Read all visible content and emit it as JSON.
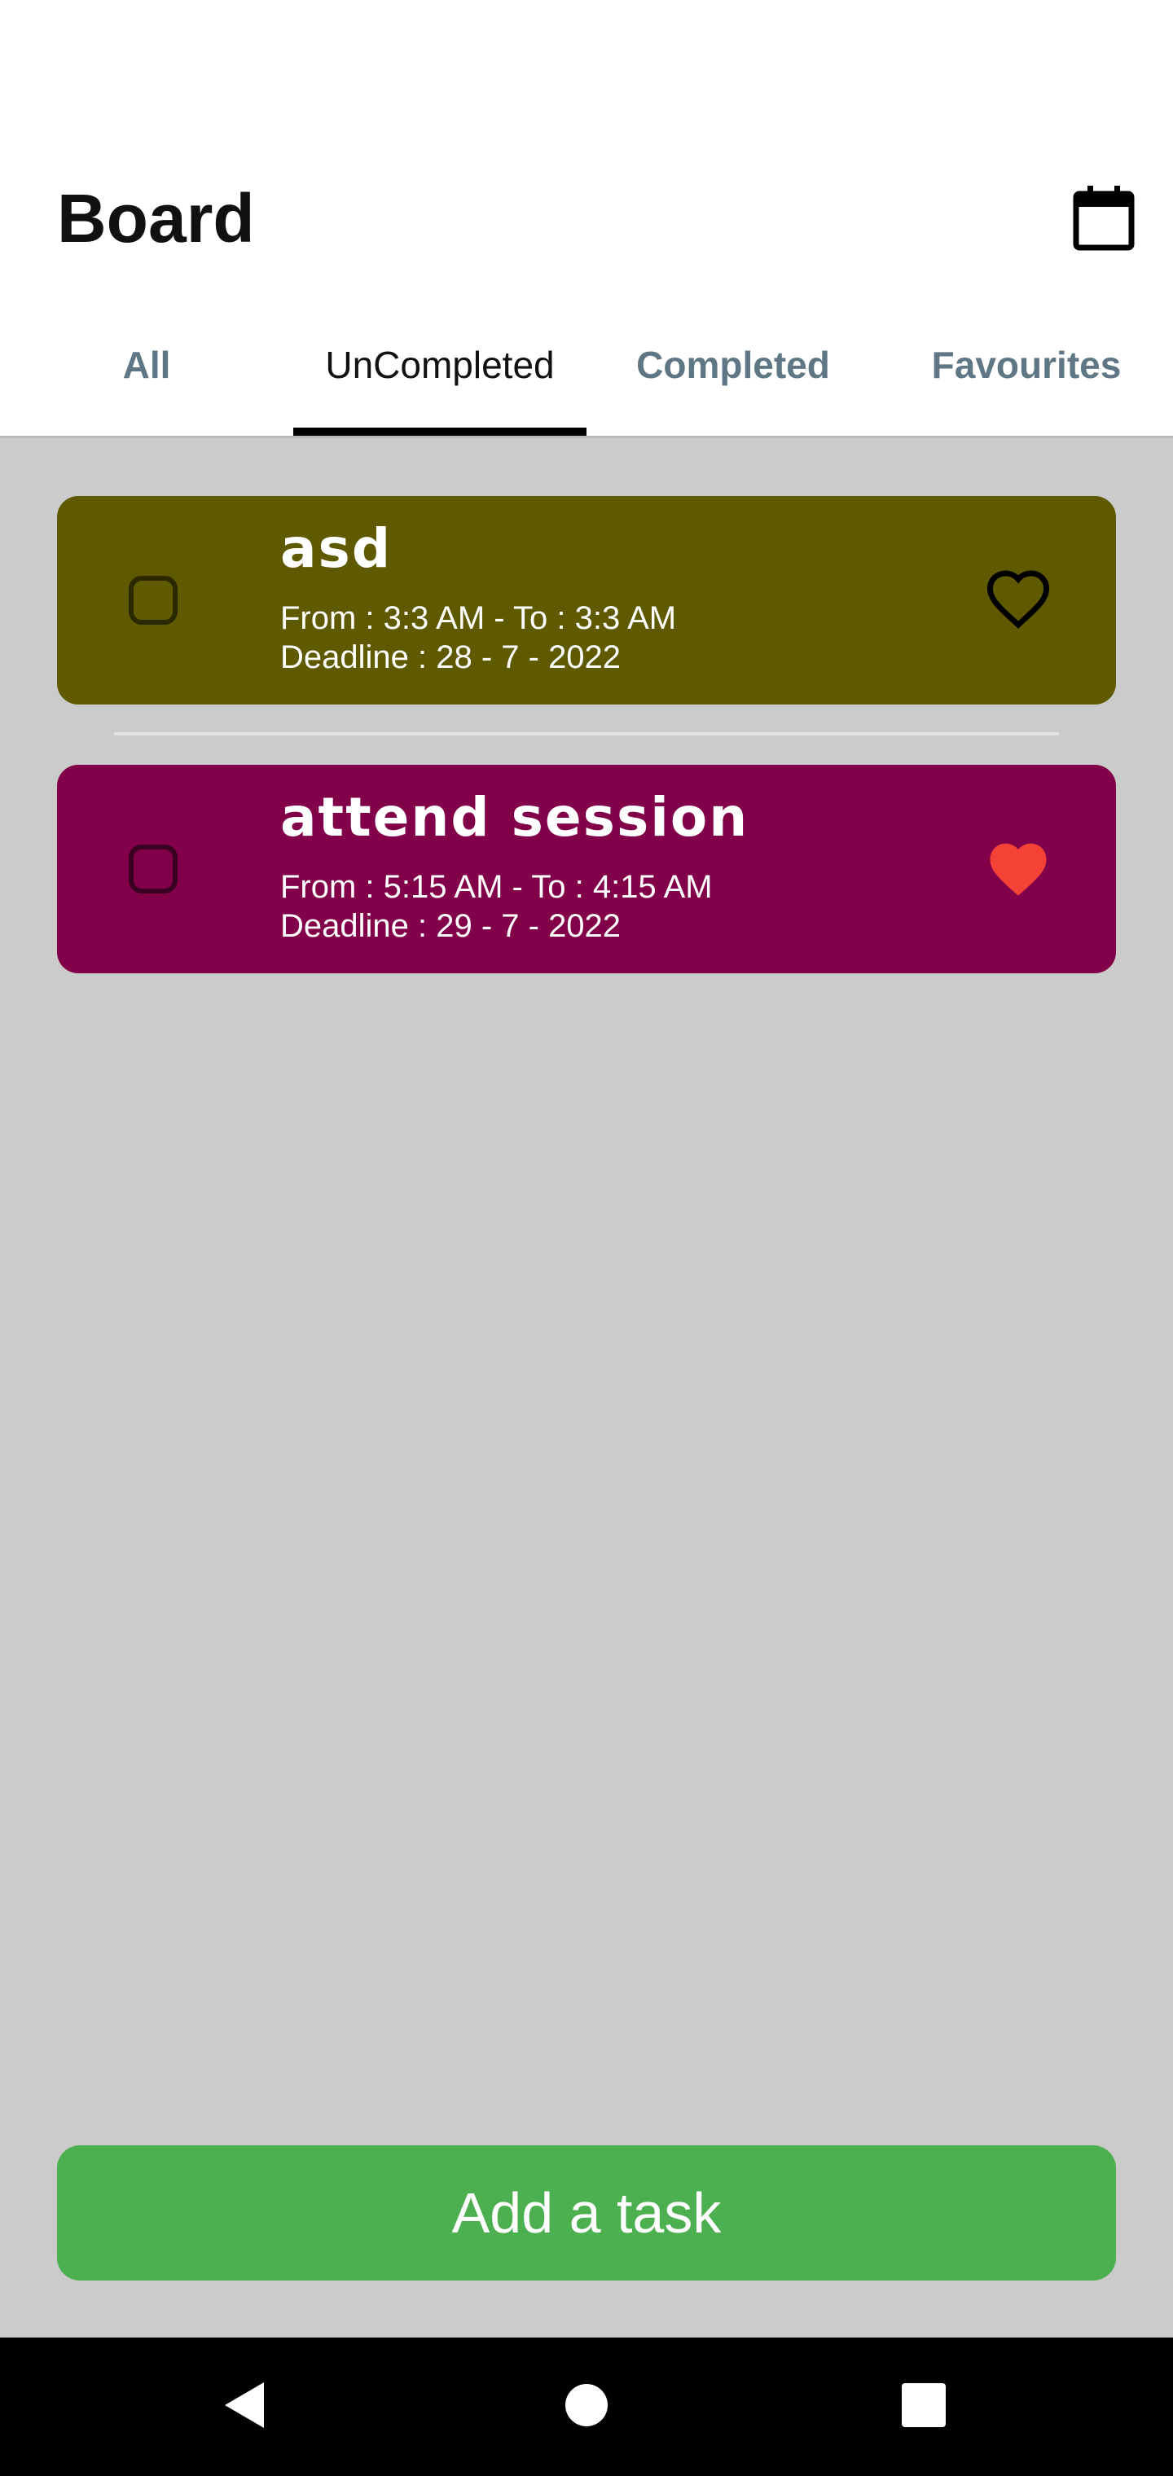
{
  "app": {
    "title": "Board"
  },
  "tabs": [
    {
      "label": "All",
      "active": false
    },
    {
      "label": "UnCompleted",
      "active": true
    },
    {
      "label": "Completed",
      "active": false
    },
    {
      "label": "Favourites",
      "active": false
    }
  ],
  "tasks": [
    {
      "title": "asd",
      "time": "From : 3:3 AM - To : 3:3 AM",
      "deadline": "Deadline : 28 - 7 - 2022",
      "color": "#5f5900",
      "favourite": false,
      "checked": false
    },
    {
      "title": "attend session",
      "time": "From : 5:15 AM - To : 4:15 AM",
      "deadline": "Deadline : 29 - 7 - 2022",
      "color": "#82004a",
      "favourite": true,
      "checked": false
    }
  ],
  "add_button": {
    "label": "Add a task"
  },
  "colors": {
    "accent": "#4caf50",
    "favourite": "#f44336",
    "list_background": "#cbcbcb",
    "tab_inactive": "#5f7784"
  },
  "icons": {
    "calendar": "calendar-icon",
    "favourite_off": "heart-outline-icon",
    "favourite_on": "heart-filled-icon",
    "nav_back": "back-triangle-icon",
    "nav_home": "home-circle-icon",
    "nav_recents": "recents-square-icon"
  }
}
